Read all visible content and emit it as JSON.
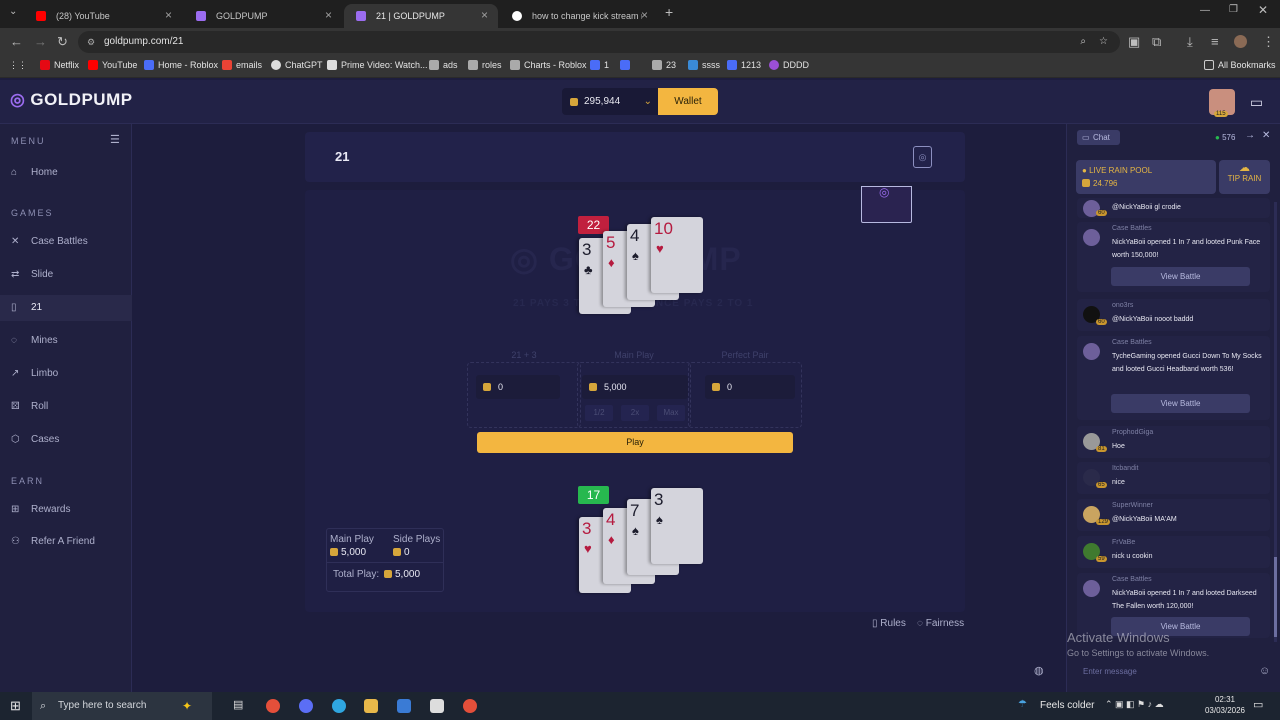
{
  "browser": {
    "tabs": [
      {
        "label": "(28) YouTube",
        "favicon_color": "#ff0000"
      },
      {
        "label": "GOLDPUMP",
        "favicon_color": "#9b6cf0"
      },
      {
        "label": "21 | GOLDPUMP",
        "favicon_color": "#9b6cf0"
      },
      {
        "label": "how to change kick stream nam",
        "favicon_color": "#ffffff"
      }
    ],
    "url": "goldpump.com/21",
    "bookmarks": [
      "Netflix",
      "YouTube",
      "Home - Roblox",
      "emails",
      "ChatGPT",
      "Prime Video: Watch...",
      "ads",
      "roles",
      "Charts - Roblox",
      "1",
      "",
      "23",
      "ssss",
      "1213",
      "DDDD"
    ],
    "all_bookmarks": "All Bookmarks"
  },
  "header": {
    "logo_text": "GOLDPUMP",
    "balance": "295,944",
    "wallet_label": "Wallet",
    "avatar_level": "115"
  },
  "sidebar": {
    "menu_title": "MENU",
    "games_title": "GAMES",
    "earn_title": "EARN",
    "items": [
      {
        "label": "Home",
        "icon": "home-icon"
      },
      {
        "label": "Case Battles",
        "icon": "swords-icon"
      },
      {
        "label": "Slide",
        "icon": "slide-icon"
      },
      {
        "label": "21",
        "icon": "cards-icon"
      },
      {
        "label": "Mines",
        "icon": "mines-icon"
      },
      {
        "label": "Limbo",
        "icon": "limbo-icon"
      },
      {
        "label": "Roll",
        "icon": "dice-icon"
      },
      {
        "label": "Cases",
        "icon": "box-icon"
      },
      {
        "label": "Rewards",
        "icon": "gift-icon"
      },
      {
        "label": "Refer A Friend",
        "icon": "user-plus-icon"
      }
    ]
  },
  "game": {
    "title": "21",
    "watermark": "GOLDPUMP",
    "watermark_sub": "21 PAYS 3 TO 1 · INSURANCE PAYS 2 TO 1",
    "dealer": {
      "total": "22",
      "cards": [
        {
          "value": "3",
          "suit": "♣",
          "color": "blk"
        },
        {
          "value": "5",
          "suit": "♦",
          "color": "red"
        },
        {
          "value": "4",
          "suit": "♠",
          "color": "blk"
        },
        {
          "value": "10",
          "suit": "♥",
          "color": "red"
        }
      ]
    },
    "player": {
      "total": "17",
      "cards": [
        {
          "value": "3",
          "suit": "♥",
          "color": "red"
        },
        {
          "value": "4",
          "suit": "♦",
          "color": "red"
        },
        {
          "value": "7",
          "suit": "♠",
          "color": "blk"
        },
        {
          "value": "3",
          "suit": "♠",
          "color": "blk"
        }
      ]
    },
    "bets": {
      "side1_label": "21 + 3",
      "side1_value": "0",
      "main_label": "Main Play",
      "main_value": "5,000",
      "side2_label": "Perfect Pair",
      "side2_value": "0",
      "half": "1/2",
      "double": "2x",
      "max": "Max"
    },
    "play_label": "Play",
    "summary": {
      "main_label": "Main Play",
      "main_value": "5,000",
      "side_label": "Side Plays",
      "side_value": "0",
      "total_label": "Total Play:",
      "total_value": "5,000"
    },
    "rules_label": "Rules",
    "fairness_label": "Fairness"
  },
  "chat": {
    "tab_label": "Chat",
    "online": "576",
    "rain_title": "LIVE RAIN POOL",
    "rain_amount": "24.796",
    "tip_rain": "TIP RAIN",
    "input_placeholder": "Enter message",
    "messages": [
      {
        "name": "",
        "text": "@NickYaBoii gl crodie",
        "level": "60"
      },
      {
        "name": "Case Battles",
        "text": "NickYaBoii opened 1 In 7 and looted Punk Face worth 150,000!",
        "level": "",
        "button": "View Battle"
      },
      {
        "name": "ono3rs",
        "text": "@NickYaBoii nooot baddd",
        "level": "60"
      },
      {
        "name": "Case Battles",
        "text": "TycheGaming opened Gucci Down To My Socks and looted Gucci Headband worth 536!",
        "level": "",
        "button": "View Battle"
      },
      {
        "name": "ProphodGiga",
        "text": "Hoe",
        "level": "81"
      },
      {
        "name": "Itcbandit",
        "text": "nice",
        "level": "65"
      },
      {
        "name": "SuperWinner",
        "text": "@NickYaBoii MA'AM",
        "level": "129"
      },
      {
        "name": "FrVaBe",
        "text": "nick u cookin",
        "level": "59"
      },
      {
        "name": "Case Battles",
        "text": "NickYaBoii opened 1 In 7 and looted Darkseed The Fallen worth 120,000!",
        "level": "",
        "button": "View Battle"
      }
    ],
    "activate_title": "Activate Windows",
    "activate_sub": "Go to Settings to activate Windows."
  },
  "taskbar": {
    "search_placeholder": "Type here to search",
    "weather": "Feels colder",
    "time": "02:31",
    "date": "03/03/2026"
  }
}
